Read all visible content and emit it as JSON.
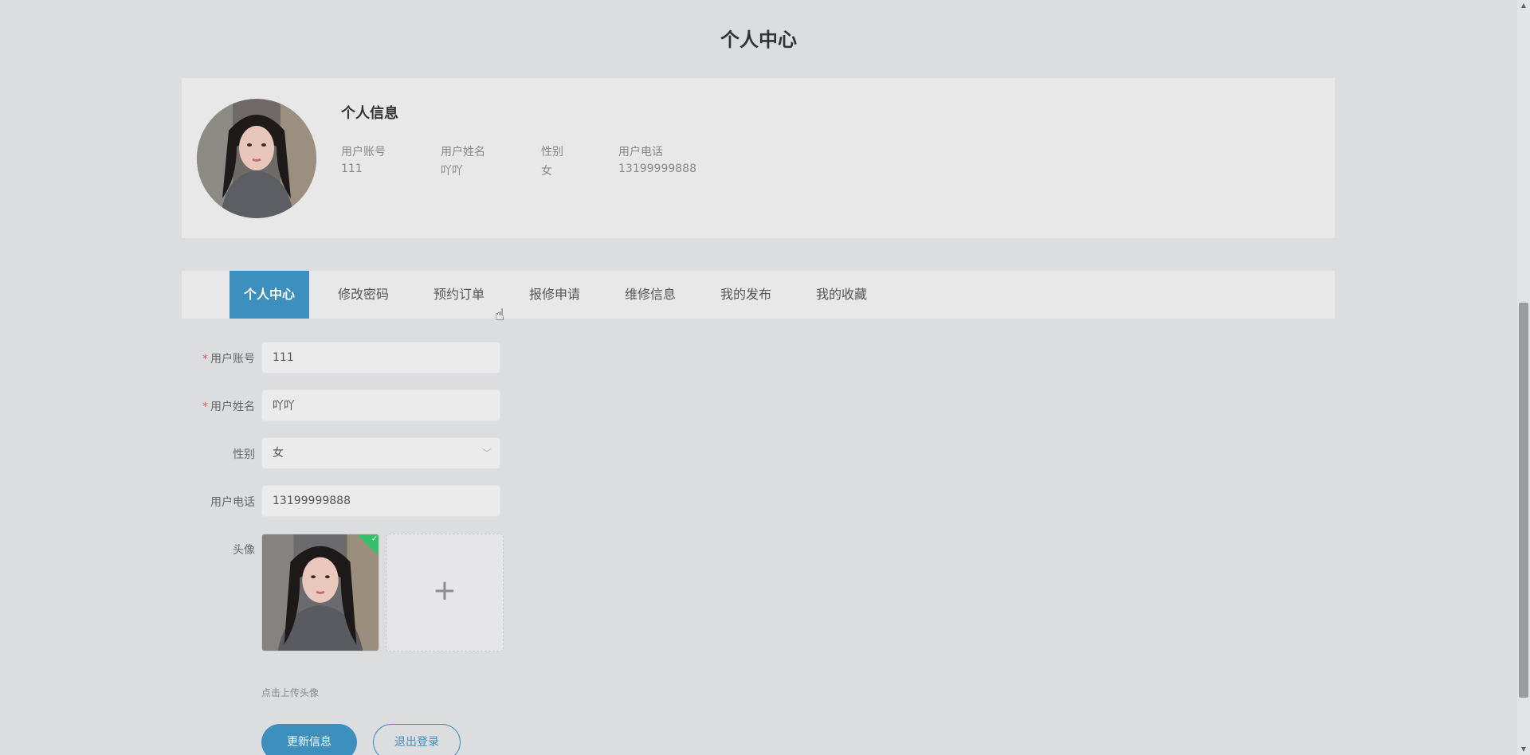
{
  "page": {
    "title": "个人中心"
  },
  "profile": {
    "section_title": "个人信息",
    "fields": [
      {
        "label": "用户账号",
        "value": "111"
      },
      {
        "label": "用户姓名",
        "value": "吖吖"
      },
      {
        "label": "性别",
        "value": "女"
      },
      {
        "label": "用户电话",
        "value": "13199999888"
      }
    ]
  },
  "tabs": [
    {
      "label": "个人中心",
      "active": true
    },
    {
      "label": "修改密码"
    },
    {
      "label": "预约订单"
    },
    {
      "label": "报修申请"
    },
    {
      "label": "维修信息"
    },
    {
      "label": "我的发布"
    },
    {
      "label": "我的收藏"
    }
  ],
  "form": {
    "account": {
      "label": "用户账号",
      "value": "111",
      "required": true
    },
    "name": {
      "label": "用户姓名",
      "value": "吖吖",
      "required": true
    },
    "gender": {
      "label": "性别",
      "value": "女"
    },
    "phone": {
      "label": "用户电话",
      "value": "13199999888"
    },
    "avatar": {
      "label": "头像",
      "hint": "点击上传头像",
      "upload_icon": "plus-icon"
    }
  },
  "buttons": {
    "update": "更新信息",
    "logout": "退出登录"
  },
  "colors": {
    "accent": "#3d8fbe",
    "required": "#e05a5a",
    "success": "#36c06a",
    "background": "#dcdddf",
    "panel": "#e8e8e9"
  }
}
